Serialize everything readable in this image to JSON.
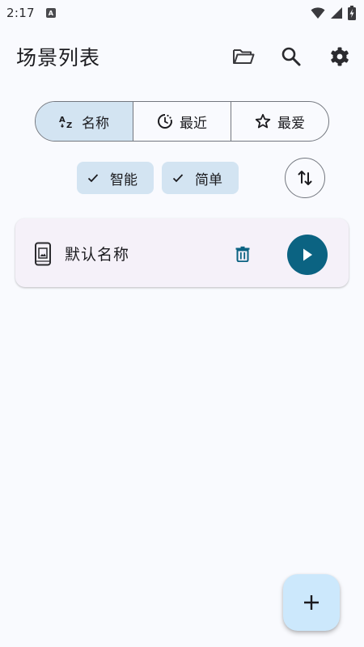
{
  "status_bar": {
    "time": "2:17",
    "notification_badge": "A",
    "icons": [
      "wifi-icon",
      "signal-icon",
      "battery-charging-icon"
    ]
  },
  "app_bar": {
    "title": "场景列表",
    "actions": [
      "folder-open-icon",
      "search-icon",
      "gear-icon"
    ]
  },
  "sort_tabs": [
    {
      "label": "名称",
      "icon": "sort-alpha-icon",
      "selected": true
    },
    {
      "label": "最近",
      "icon": "recent-clock-icon",
      "selected": false
    },
    {
      "label": "最爱",
      "icon": "star-outline-icon",
      "selected": false
    }
  ],
  "filter_chips": [
    {
      "label": "智能",
      "checked": true
    },
    {
      "label": "简单",
      "checked": true
    }
  ],
  "sort_direction_icon": "swap-vertical-icon",
  "scenes": [
    {
      "name": "默认名称",
      "icon": "phone-scene-icon"
    }
  ],
  "fab_icon": "plus-icon",
  "colors": {
    "background": "#f9fafe",
    "accent_tonal": "#d3e4f2",
    "play_button": "#0b6382",
    "delete_icon": "#0b6382",
    "fab": "#cce8fc",
    "card": "#f5f1f9",
    "outline": "#73777f"
  }
}
